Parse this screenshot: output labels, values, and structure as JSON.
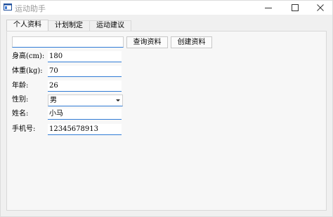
{
  "window": {
    "title": "运动助手"
  },
  "tabs": [
    {
      "label": "个人资料"
    },
    {
      "label": "计划制定"
    },
    {
      "label": "运动建议"
    }
  ],
  "toolbar": {
    "search_value": "",
    "query_label": "查询资料",
    "create_label": "创建资料"
  },
  "form": {
    "height": {
      "label": "身高(cm):",
      "value": "180"
    },
    "weight": {
      "label": "体重(kg):",
      "value": "70"
    },
    "age": {
      "label": "年龄:",
      "value": "26"
    },
    "gender": {
      "label": "性别:",
      "value": "男"
    },
    "name": {
      "label": "姓名:",
      "value": "小马"
    },
    "phone": {
      "label": "手机号:",
      "value": "12345678913"
    }
  },
  "colors": {
    "accent": "#2f7bd6",
    "background": "#f0f0f0"
  }
}
